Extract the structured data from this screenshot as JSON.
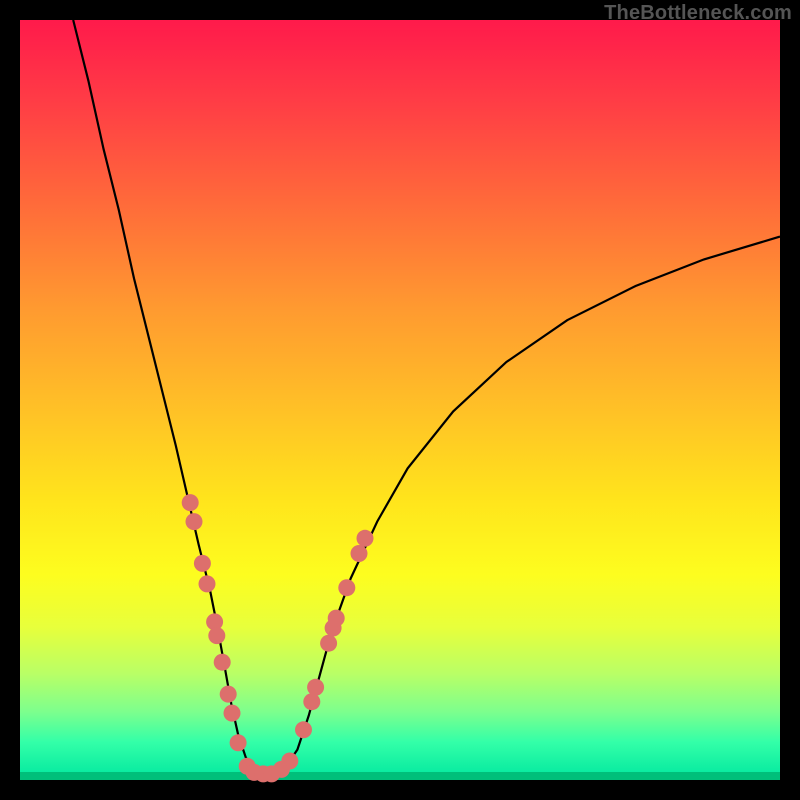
{
  "attribution": "TheBottleneck.com",
  "colors": {
    "marker": "#dd6f6c",
    "curve": "#000000",
    "frame": "#000000"
  },
  "chart_data": {
    "type": "line",
    "title": "",
    "xlabel": "",
    "ylabel": "",
    "xlim": [
      0,
      100
    ],
    "ylim": [
      0,
      100
    ],
    "grid": false,
    "legend": false,
    "note": "Axes are unlabeled in the image; values are estimated from pixel positions on a 0–100 normalized scale. Lower y = closer to the green optimum.",
    "series": [
      {
        "name": "curve",
        "x": [
          7,
          9,
          11,
          13,
          15,
          17,
          19,
          20.5,
          22,
          23.5,
          25,
          26,
          27,
          27.8,
          28.7,
          29.7,
          30.7,
          33,
          35,
          36.5,
          38,
          39.5,
          41,
          43.5,
          47,
          51,
          57,
          64,
          72,
          81,
          90,
          100
        ],
        "y": [
          100,
          92,
          83,
          75,
          66,
          58,
          50,
          44,
          37.5,
          31,
          25,
          20,
          14.5,
          10,
          6,
          3,
          1.3,
          0.8,
          1.8,
          4,
          8.5,
          14,
          19.5,
          26.5,
          34,
          41,
          48.5,
          55,
          60.5,
          65,
          68.5,
          71.5
        ]
      }
    ],
    "markers": {
      "name": "highlighted-points",
      "points": [
        {
          "x": 22.4,
          "y": 36.5
        },
        {
          "x": 22.9,
          "y": 34.0
        },
        {
          "x": 24.0,
          "y": 28.5
        },
        {
          "x": 24.6,
          "y": 25.8
        },
        {
          "x": 25.6,
          "y": 20.8
        },
        {
          "x": 25.9,
          "y": 19.0
        },
        {
          "x": 26.6,
          "y": 15.5
        },
        {
          "x": 27.4,
          "y": 11.3
        },
        {
          "x": 27.9,
          "y": 8.8
        },
        {
          "x": 28.7,
          "y": 4.9
        },
        {
          "x": 29.9,
          "y": 1.8
        },
        {
          "x": 30.8,
          "y": 1.0
        },
        {
          "x": 32.0,
          "y": 0.8
        },
        {
          "x": 33.1,
          "y": 0.8
        },
        {
          "x": 34.4,
          "y": 1.4
        },
        {
          "x": 35.5,
          "y": 2.5
        },
        {
          "x": 37.3,
          "y": 6.6
        },
        {
          "x": 38.4,
          "y": 10.3
        },
        {
          "x": 38.9,
          "y": 12.2
        },
        {
          "x": 40.6,
          "y": 18.0
        },
        {
          "x": 41.2,
          "y": 20.0
        },
        {
          "x": 41.6,
          "y": 21.3
        },
        {
          "x": 43.0,
          "y": 25.3
        },
        {
          "x": 44.6,
          "y": 29.8
        },
        {
          "x": 45.4,
          "y": 31.8
        }
      ]
    }
  }
}
